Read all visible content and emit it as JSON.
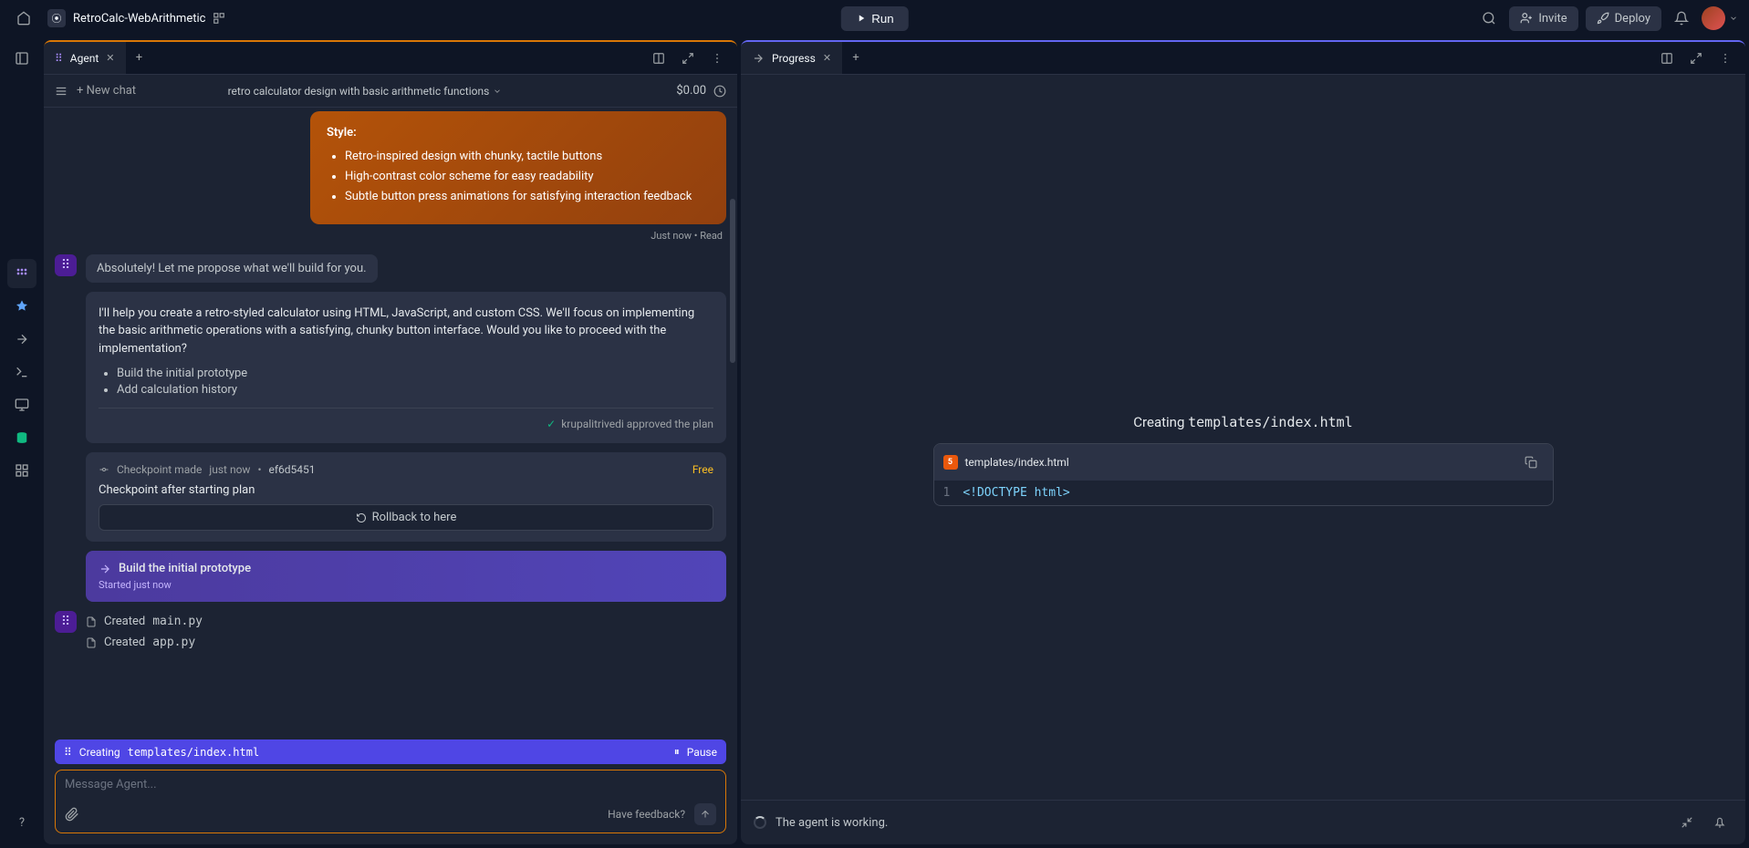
{
  "topbar": {
    "project": "RetroCalc-WebArithmetic",
    "run": "Run",
    "invite": "Invite",
    "deploy": "Deploy"
  },
  "left": {
    "tab": "Agent",
    "newChat": "New chat",
    "threadTitle": "retro calculator design with basic arithmetic functions",
    "cost": "$0.00",
    "userMsg": {
      "styleHeader": "Style:",
      "bullets": [
        "Retro-inspired design with chunky, tactile buttons",
        "High-contrast color scheme for easy readability",
        "Subtle button press animations for satisfying interaction feedback"
      ],
      "meta": "Just now • Read"
    },
    "agentIntro": "Absolutely! Let me propose what we'll build for you.",
    "agentPlan": {
      "para": "I'll help you create a retro-styled calculator using HTML, JavaScript, and custom CSS. We'll focus on implementing the basic arithmetic operations with a satisfying, chunky button interface. Would you like to proceed with the implementation?",
      "items": [
        "Build the initial prototype",
        "Add calculation history"
      ],
      "approved": "krupalitrivedi approved the plan"
    },
    "checkpoint": {
      "label": "Checkpoint made",
      "time": "just now",
      "hash": "ef6d5451",
      "free": "Free",
      "desc": "Checkpoint after starting plan",
      "rollback": "Rollback to here"
    },
    "task": {
      "title": "Build the initial prototype",
      "sub": "Started just now"
    },
    "created": {
      "word": "Created",
      "file1": "main.py",
      "file2": "app.py"
    },
    "creating": {
      "word": "Creating",
      "file": "templates/index.html",
      "pause": "Pause"
    },
    "input": {
      "placeholder": "Message Agent...",
      "feedback": "Have feedback?"
    }
  },
  "right": {
    "tab": "Progress",
    "titlePrefix": "Creating ",
    "titlePath": "templates/index.html",
    "filePath": "templates/index.html",
    "lineNum": "1",
    "codeDoctype": "<!DOCTYPE ",
    "codeTag": "html",
    "codeClose": ">",
    "footer": "The agent is working."
  }
}
